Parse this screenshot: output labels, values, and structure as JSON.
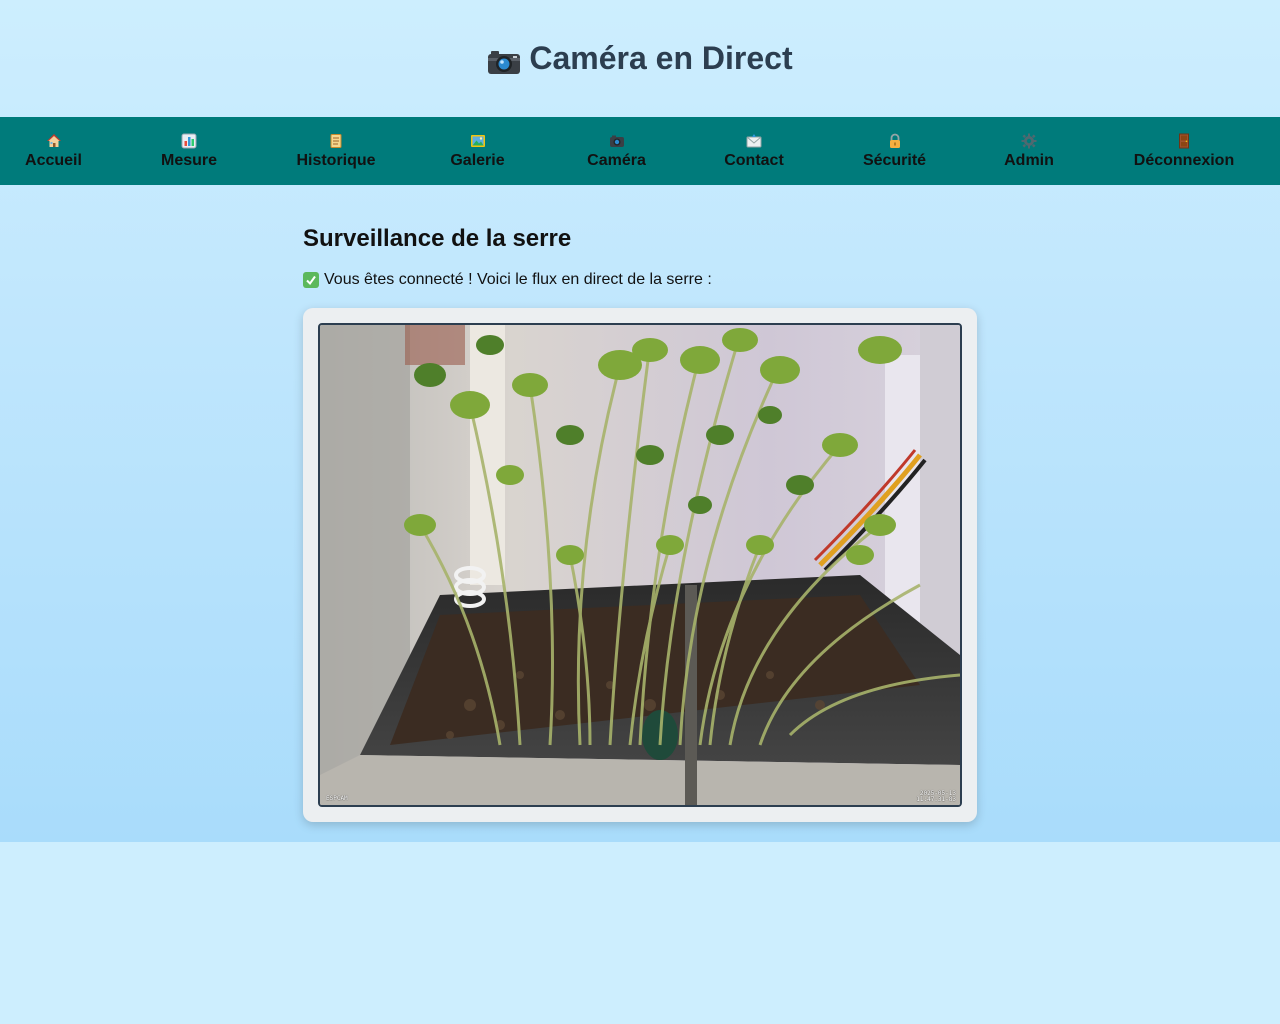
{
  "header": {
    "title": "Caméra en Direct",
    "icon": "camera-icon"
  },
  "nav": {
    "items": [
      {
        "label": "Accueil",
        "icon": "house-icon"
      },
      {
        "label": "Mesure",
        "icon": "bar-chart-icon"
      },
      {
        "label": "Historique",
        "icon": "scroll-icon"
      },
      {
        "label": "Galerie",
        "icon": "picture-icon"
      },
      {
        "label": "Caméra",
        "icon": "camera-icon"
      },
      {
        "label": "Contact",
        "icon": "envelope-icon"
      },
      {
        "label": "Sécurité",
        "icon": "lock-icon"
      },
      {
        "label": "Admin",
        "icon": "gear-icon"
      },
      {
        "label": "Déconnexion",
        "icon": "door-icon"
      }
    ]
  },
  "main": {
    "heading": "Surveillance de la serre",
    "status_text": "Vous êtes connecté ! Voici le flux en direct de la serre :",
    "status_icon": "check-mark-icon"
  },
  "video": {
    "timestamp_date": "2025-05-13",
    "timestamp_time": "11:47:31-83"
  },
  "colors": {
    "nav_bg": "#007b7b",
    "title": "#2c3e50",
    "card_bg": "#eceff1",
    "check": "#5cb85c"
  }
}
